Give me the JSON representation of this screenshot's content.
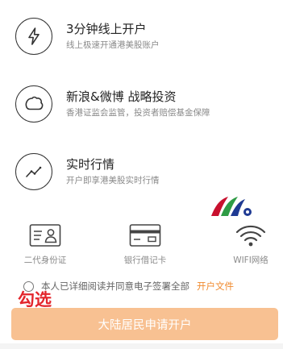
{
  "features": [
    {
      "title": "3分钟线上开户",
      "subtitle": "线上极速开通港美股账户",
      "icon": "lightning-icon"
    },
    {
      "title": "新浪&微博 战略投资",
      "subtitle": "香港证监会监管，投资者赔偿基金保障",
      "icon": "leaf-shield-icon"
    },
    {
      "title": "实时行情",
      "subtitle": "开户即享港美股实时行情",
      "icon": "trend-line-icon"
    }
  ],
  "cards": [
    {
      "label": "二代身份证",
      "icon": "id-card-icon"
    },
    {
      "label": "银行借记卡",
      "icon": "bank-card-icon"
    },
    {
      "label": "WIFI网络",
      "icon": "wifi-icon"
    }
  ],
  "agreement": {
    "text": "本人已详细阅读并同意电子签署全部",
    "link": "开户文件"
  },
  "annotation": "勾选",
  "submit_button": "大陆居民申请开户",
  "colors": {
    "accent": "#f08a2e",
    "button_bg": "#f8c192",
    "annotation_red": "#e3262c",
    "logo_red": "#c8102e",
    "logo_green": "#2e9b45",
    "logo_blue": "#1f3a93"
  }
}
